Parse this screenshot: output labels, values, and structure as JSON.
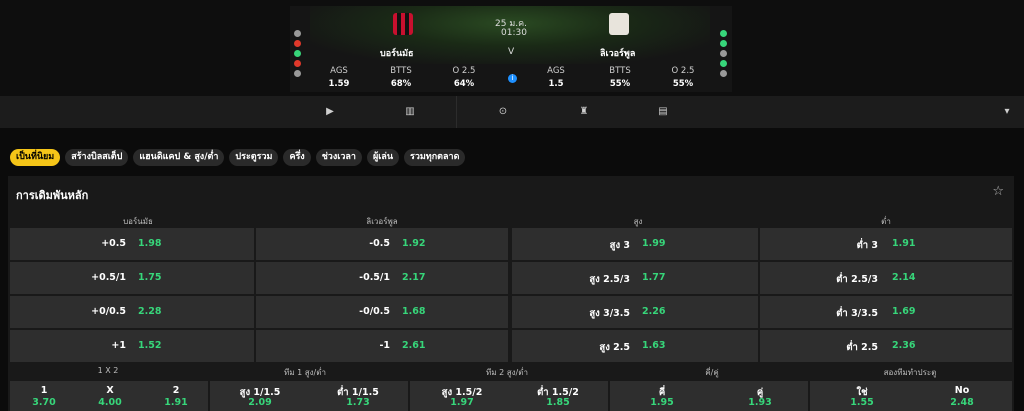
{
  "match": {
    "date": "25 ม.ค.",
    "time": "01:30",
    "home": "บอร์นมัธ",
    "away": "ลิเวอร์พูล",
    "vs": "V",
    "home_form": [
      "#9a9a9a",
      "#e0392b",
      "#37d67a",
      "#e0392b",
      "#9a9a9a"
    ],
    "away_form": [
      "#37d67a",
      "#37d67a",
      "#9a9a9a",
      "#37d67a",
      "#9a9a9a"
    ],
    "home_stats": [
      {
        "label": "AGS",
        "value": "1.59"
      },
      {
        "label": "BTTS",
        "value": "68%"
      },
      {
        "label": "O 2.5",
        "value": "64%"
      }
    ],
    "away_stats": [
      {
        "label": "AGS",
        "value": "1.5"
      },
      {
        "label": "BTTS",
        "value": "55%"
      },
      {
        "label": "O 2.5",
        "value": "55%"
      }
    ]
  },
  "nav": {
    "icons": [
      "play-icon",
      "stats-icon",
      "vs-icon",
      "shirt-icon",
      "scoreboard-icon"
    ],
    "dropdown": "▾"
  },
  "chips": [
    "เป็นที่นิยม",
    "สร้างบิลสเต็ป",
    "แฮนดิแคป & สูง/ต่ำ",
    "ประตูรวม",
    "ครึ่ง",
    "ช่วงเวลา",
    "ผู้เล่น",
    "รวมทุกตลาด"
  ],
  "panel": {
    "title": "การเดิมพันหลัก",
    "headers": [
      "บอร์นมัธ",
      "ลิเวอร์พูล",
      "สูง",
      "ต่ำ"
    ],
    "rows": [
      {
        "h": "+0.5",
        "ho": "1.98",
        "a": "-0.5",
        "ao": "1.92",
        "o": "สูง 3",
        "oo": "1.99",
        "u": "ต่ำ 3",
        "uo": "1.91"
      },
      {
        "h": "+0.5/1",
        "ho": "1.75",
        "a": "-0.5/1",
        "ao": "2.17",
        "o": "สูง 2.5/3",
        "oo": "1.77",
        "u": "ต่ำ 2.5/3",
        "uo": "2.14"
      },
      {
        "h": "+0/0.5",
        "ho": "2.28",
        "a": "-0/0.5",
        "ao": "1.68",
        "o": "สูง 3/3.5",
        "oo": "2.26",
        "u": "ต่ำ 3/3.5",
        "uo": "1.69"
      },
      {
        "h": "+1",
        "ho": "1.52",
        "a": "-1",
        "ao": "2.61",
        "o": "สูง 2.5",
        "oo": "1.63",
        "u": "ต่ำ 2.5",
        "uo": "2.36"
      }
    ],
    "sub_headers": [
      "1 X 2",
      "ทีม 1 สูง/ต่ำ",
      "ทีม 2 สูง/ต่ำ",
      "คี่/คู่",
      "สองทีมทำประตู"
    ],
    "bottom": [
      {
        "l": "1",
        "o": "3.70"
      },
      {
        "l": "X",
        "o": "4.00"
      },
      {
        "l": "2",
        "o": "1.91"
      },
      {
        "l": "สูง 1/1.5",
        "o": "2.09"
      },
      {
        "l": "ต่ำ 1/1.5",
        "o": "1.73"
      },
      {
        "l": "สูง 1.5/2",
        "o": "1.97"
      },
      {
        "l": "ต่ำ 1.5/2",
        "o": "1.85"
      },
      {
        "l": "คี่",
        "o": "1.95"
      },
      {
        "l": "คู่",
        "o": "1.93"
      },
      {
        "l": "ใช่",
        "o": "1.55"
      },
      {
        "l": "No",
        "o": "2.48"
      }
    ]
  }
}
